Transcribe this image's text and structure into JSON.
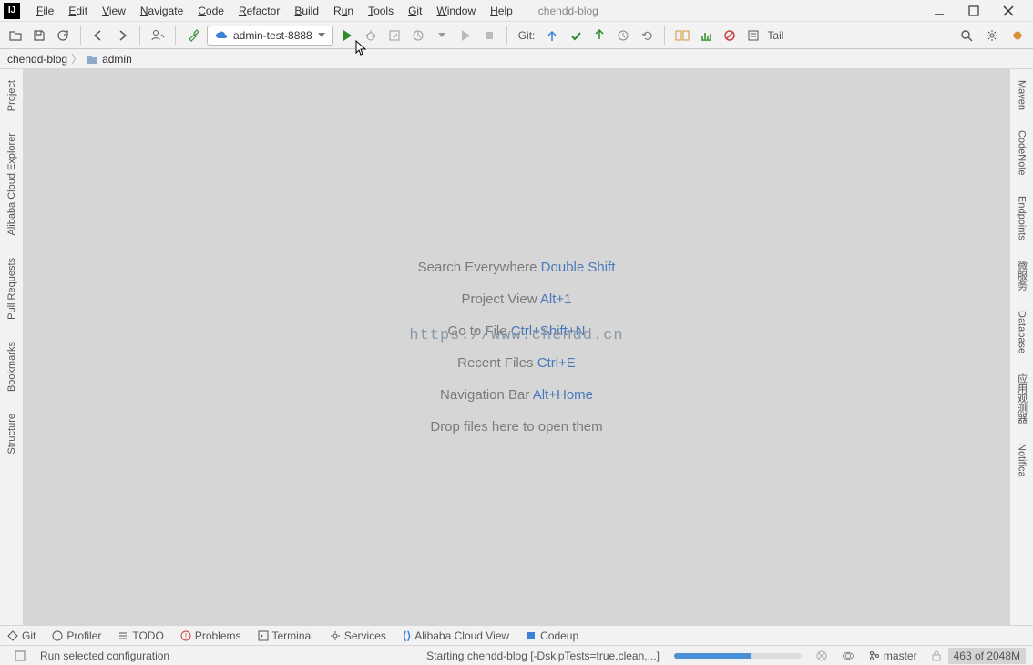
{
  "menus": [
    "File",
    "Edit",
    "View",
    "Navigate",
    "Code",
    "Refactor",
    "Build",
    "Run",
    "Tools",
    "Git",
    "Window",
    "Help"
  ],
  "projectTitle": "chendd-blog",
  "runConfig": "admin-test-8888",
  "gitLabel": "Git:",
  "tail": "Tail",
  "breadcrumb": {
    "project": "chendd-blog",
    "module": "admin"
  },
  "leftTabs": [
    "Project",
    "Alibaba Cloud Explorer",
    "Pull Requests",
    "Bookmarks",
    "Structure"
  ],
  "rightTabs": [
    "Maven",
    "CodeNote",
    "Endpoints",
    "微服务",
    "Database",
    "应用观测器",
    "Notifica"
  ],
  "tips": [
    {
      "label": "Search Everywhere",
      "shortcut": "Double Shift"
    },
    {
      "label": "Project View",
      "shortcut": "Alt+1"
    },
    {
      "label": "Go to File",
      "shortcut": "Ctrl+Shift+N"
    },
    {
      "label": "Recent Files",
      "shortcut": "Ctrl+E"
    },
    {
      "label": "Navigation Bar",
      "shortcut": "Alt+Home"
    }
  ],
  "dropHint": "Drop files here to open them",
  "watermark": "https://www.chendd.cn",
  "bottomTabs": [
    "Git",
    "Profiler",
    "TODO",
    "Problems",
    "Terminal",
    "Services",
    "Alibaba Cloud View",
    "Codeup"
  ],
  "status": {
    "left": "Run selected configuration",
    "task": "Starting chendd-blog [-DskipTests=true,clean,...]",
    "branch": "master",
    "mem": "463 of 2048M"
  }
}
